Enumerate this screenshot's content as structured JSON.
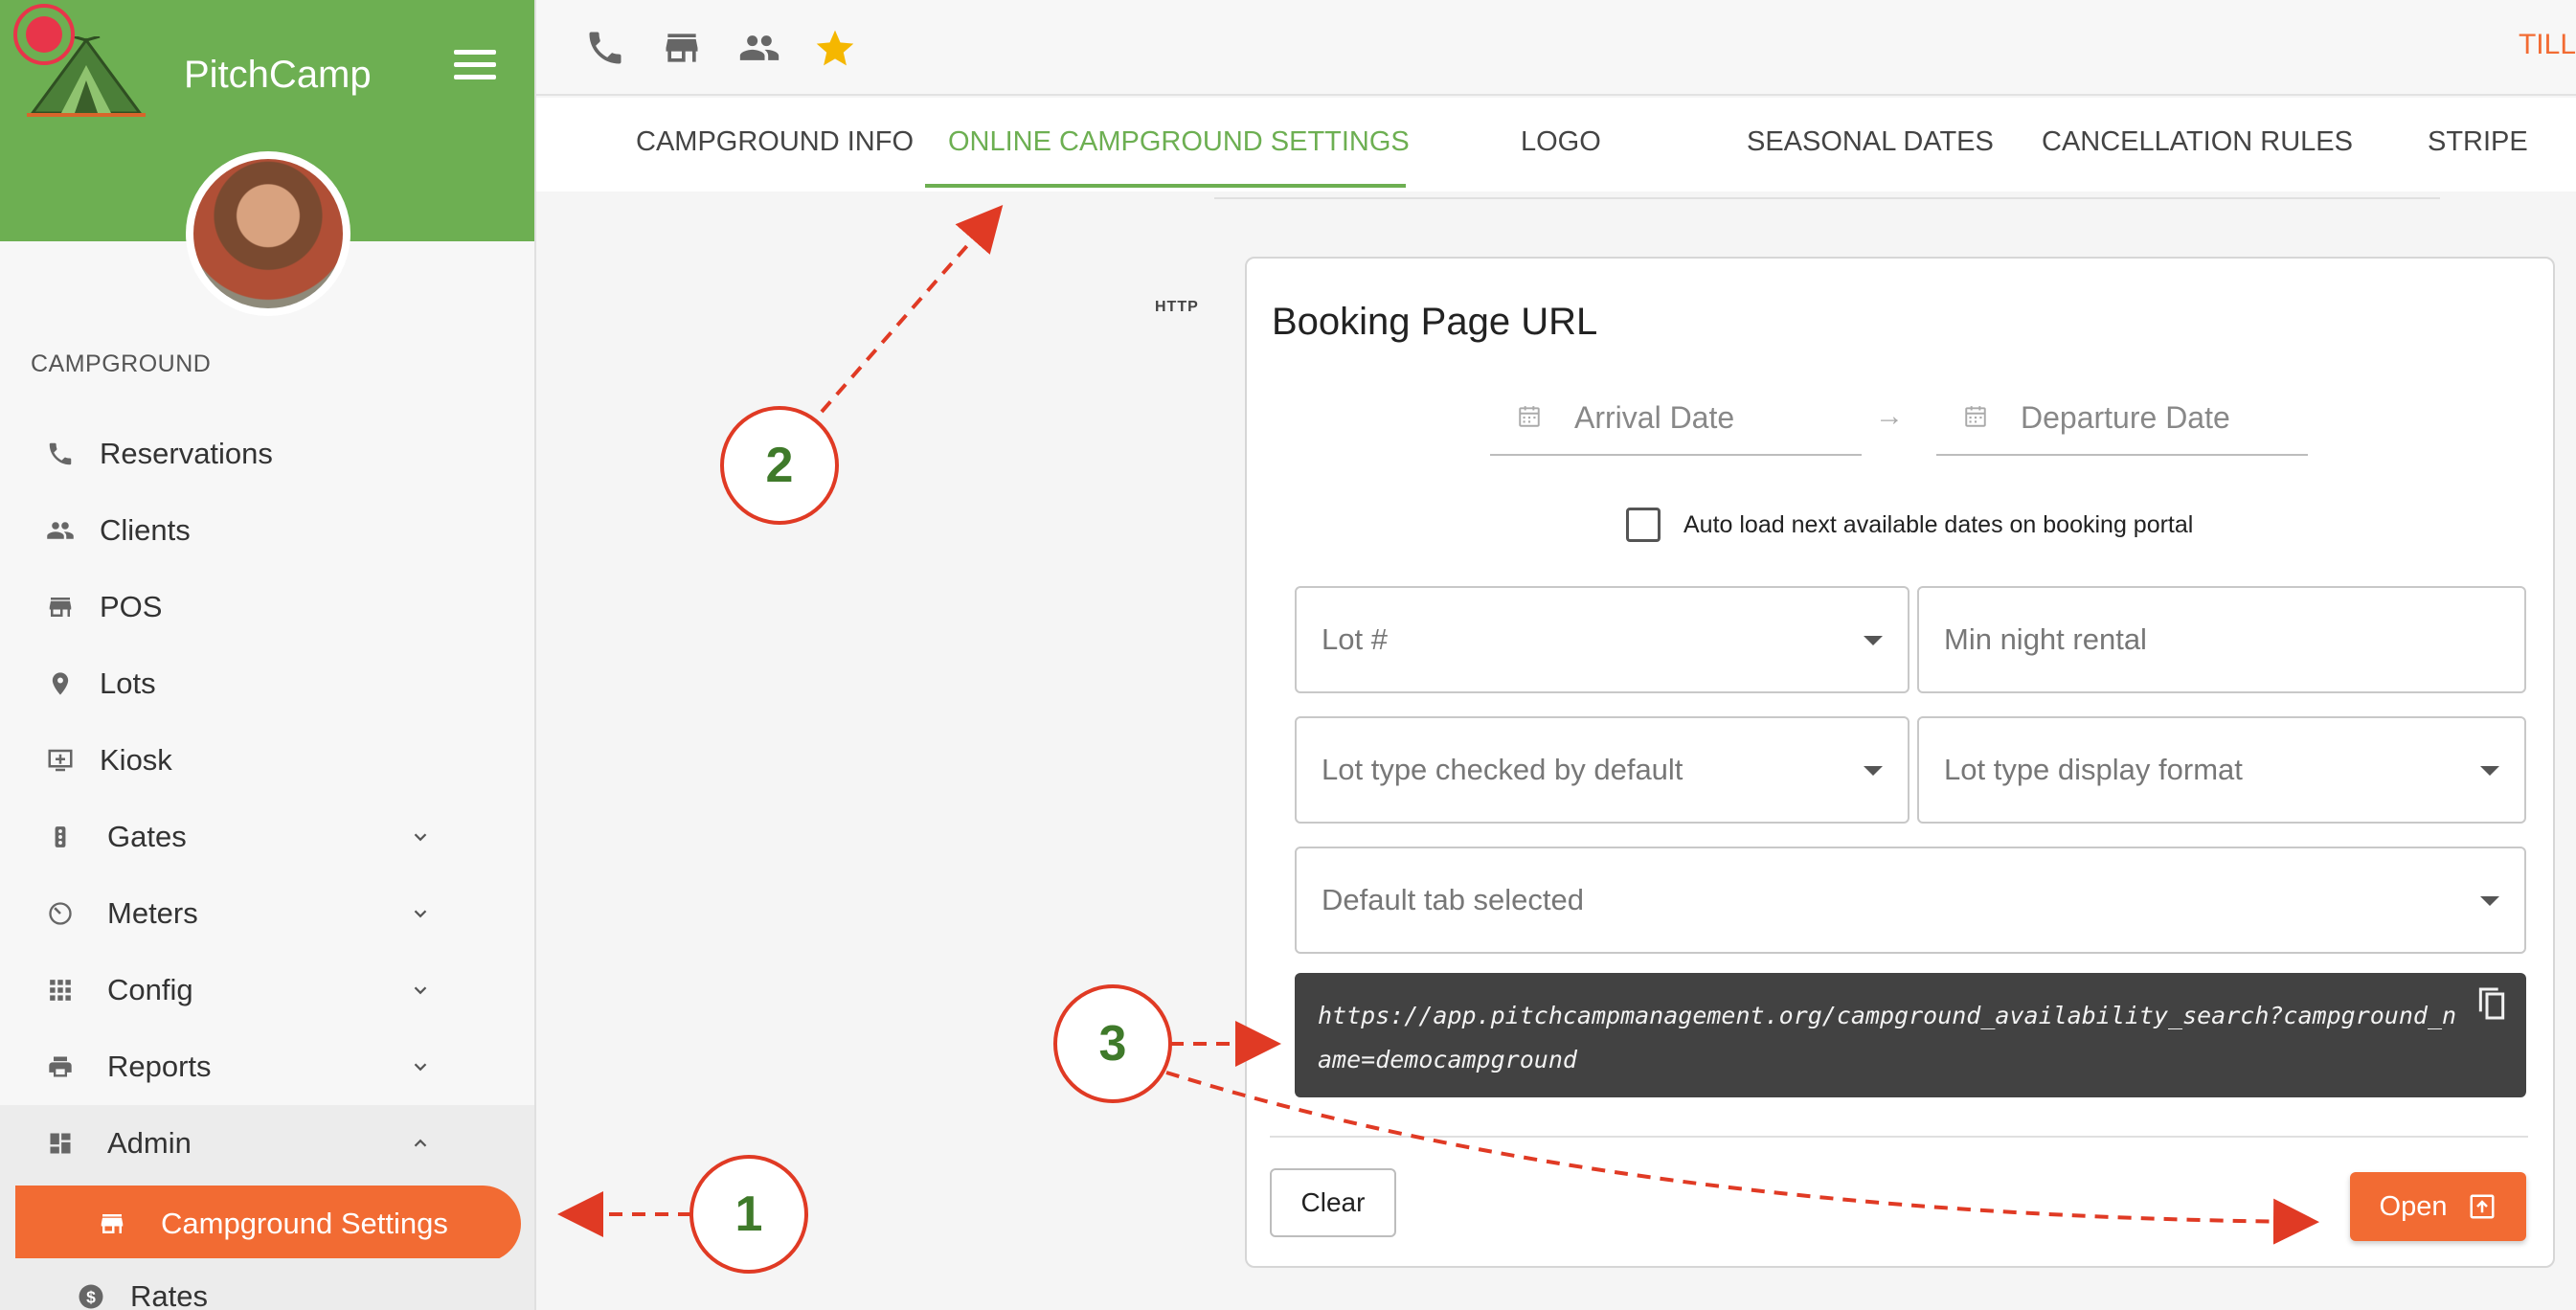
{
  "app": {
    "name": "PitchCamp"
  },
  "sidebar": {
    "section_label": "CAMPGROUND",
    "items": [
      {
        "label": "Reservations",
        "icon": "phone-icon"
      },
      {
        "label": "Clients",
        "icon": "people-icon"
      },
      {
        "label": "POS",
        "icon": "store-icon"
      },
      {
        "label": "Lots",
        "icon": "map-pin-icon"
      },
      {
        "label": "Kiosk",
        "icon": "kiosk-icon"
      },
      {
        "label": "Gates",
        "icon": "traffic-light-icon",
        "expandable": true
      },
      {
        "label": "Meters",
        "icon": "meter-icon",
        "expandable": true
      },
      {
        "label": "Config",
        "icon": "grid-icon",
        "expandable": true
      },
      {
        "label": "Reports",
        "icon": "printer-icon",
        "expandable": true
      },
      {
        "label": "Admin",
        "icon": "dashboard-icon",
        "expanded": true
      }
    ],
    "sub_items": [
      {
        "label": "Campground Settings",
        "icon": "store-icon",
        "active": true
      },
      {
        "label": "Rates",
        "icon": "dollar-icon"
      }
    ]
  },
  "topbar": {
    "icons": [
      "phone-icon",
      "store-icon",
      "people-icon",
      "star-icon"
    ],
    "right_text": "TILL"
  },
  "tabs": [
    {
      "label": "CAMPGROUND INFO",
      "active": false
    },
    {
      "label": "ONLINE CAMPGROUND SETTINGS",
      "active": true
    },
    {
      "label": "LOGO",
      "active": false
    },
    {
      "label": "SEASONAL DATES",
      "active": false
    },
    {
      "label": "CANCELLATION RULES",
      "active": false
    },
    {
      "label": "STRIPE",
      "active": false
    }
  ],
  "http_label": "HTTP",
  "card": {
    "title": "Booking Page URL",
    "arrival_placeholder": "Arrival Date",
    "departure_placeholder": "Departure Date",
    "auto_load_label": "Auto load next available dates on booking portal",
    "auto_load_checked": false,
    "lot_placeholder": "Lot #",
    "min_night_placeholder": "Min night rental",
    "lot_type_checked_placeholder": "Lot type checked by default",
    "lot_type_display_placeholder": "Lot type display format",
    "default_tab_placeholder": "Default tab selected",
    "url": "https://app.pitchcampmanagement.org/campground_availability_search?campground_name=democampground",
    "clear_label": "Clear",
    "open_label": "Open"
  },
  "annotations": [
    "1",
    "2",
    "3"
  ],
  "colors": {
    "brand_green": "#6daf52",
    "accent_orange": "#f26b33",
    "annotation_red": "#e03a24",
    "annotation_number_green": "#3f7a2a",
    "url_box_bg": "#424242"
  }
}
